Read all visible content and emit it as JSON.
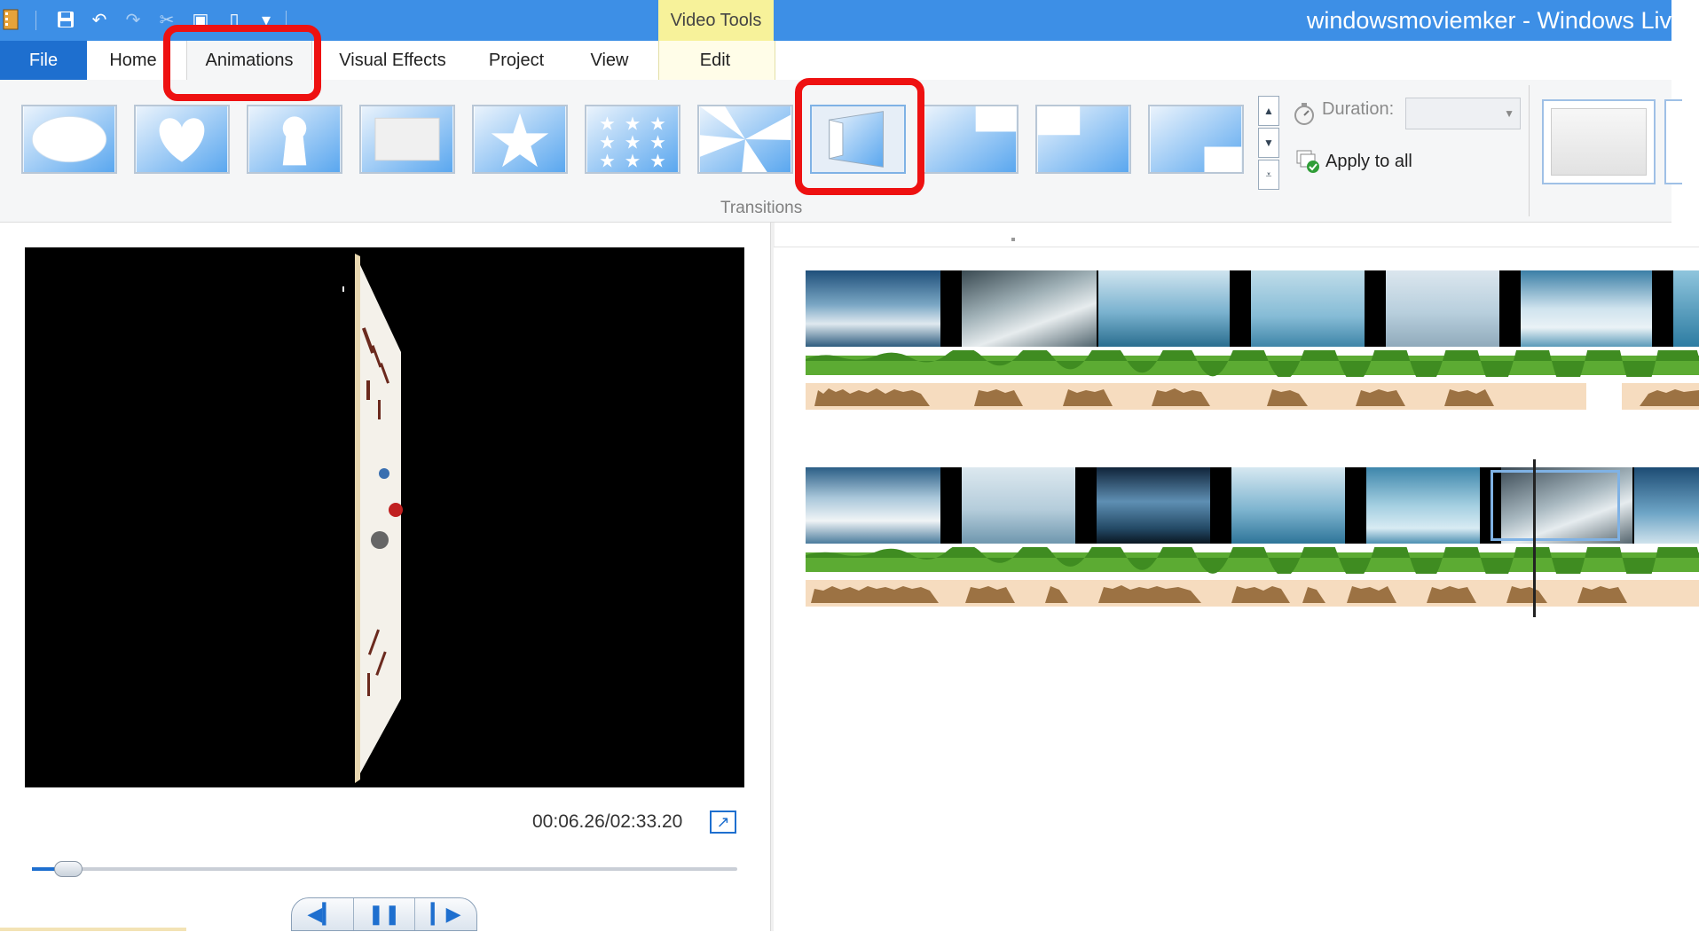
{
  "window": {
    "title": "windowsmoviemker - Windows Liv",
    "context_tab_group": "Video Tools"
  },
  "tabs": {
    "file": "File",
    "home": "Home",
    "animations": "Animations",
    "visual_effects": "Visual Effects",
    "project": "Project",
    "view": "View",
    "edit": "Edit"
  },
  "ribbon": {
    "transitions_group_label": "Transitions",
    "transitions": [
      "circle",
      "heart",
      "keyhole",
      "rectangle",
      "star",
      "stars",
      "pinwheel",
      "flip",
      "corner-wipe-1",
      "corner-wipe-2",
      "corner-wipe-3"
    ],
    "selected_transition": "flip",
    "duration_label": "Duration:",
    "duration_value": "",
    "apply_to_all_label": "Apply to all"
  },
  "preview": {
    "timecode": "00:06.26/02:33.20",
    "seek_position": 0.042
  },
  "colors": {
    "title_bar": "#3d8fe6",
    "file_tab": "#1e6fcf",
    "context_tab": "#f7f29a",
    "highlight": "#ee1111",
    "narration_track": "#5cab33",
    "music_track": "#f6dcbf",
    "music_wave": "#9c7243"
  }
}
